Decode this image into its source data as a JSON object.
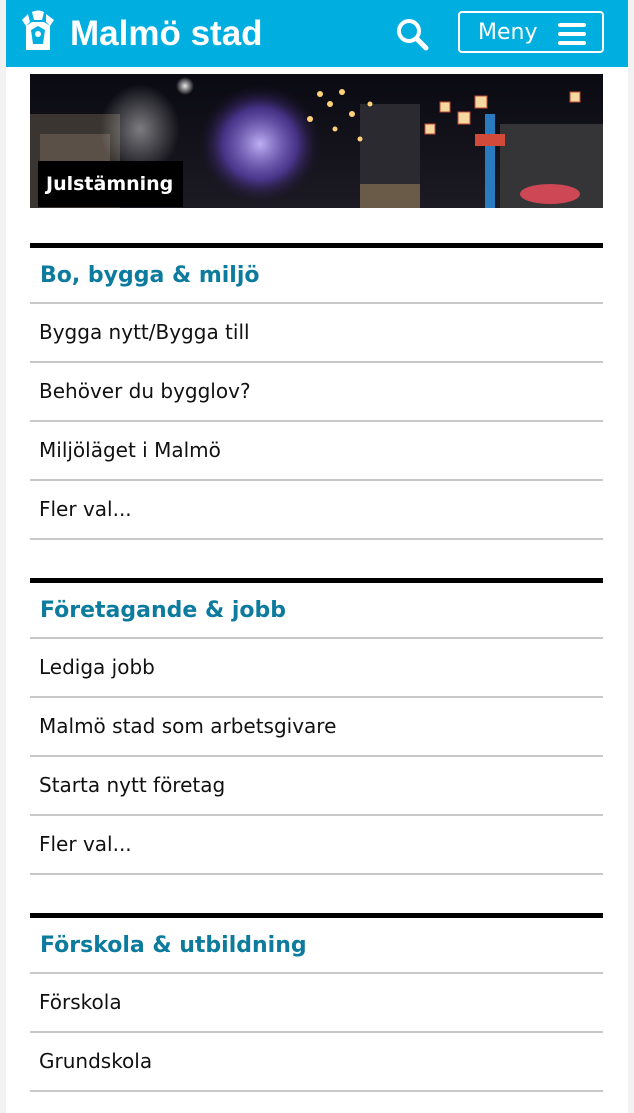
{
  "header": {
    "brand": "Malmö stad",
    "menu_label": "Meny",
    "accent": "#00aee0",
    "icons": {
      "logo": "malmo-griffin-logo",
      "search": "search-icon",
      "menu": "hamburger-icon"
    }
  },
  "hero": {
    "label": "Julstämning"
  },
  "sections": [
    {
      "title": "Bo, bygga & miljö",
      "items": [
        "Bygga nytt/Bygga till",
        "Behöver du bygglov?",
        "Miljöläget i Malmö",
        "Fler val..."
      ]
    },
    {
      "title": "Företagande & jobb",
      "items": [
        "Lediga jobb",
        "Malmö stad som arbetsgivare",
        "Starta nytt företag",
        "Fler val..."
      ]
    },
    {
      "title": "Förskola & utbildning",
      "items": [
        "Förskola",
        "Grundskola"
      ]
    }
  ],
  "colors": {
    "section_title": "#0d7b9e",
    "divider": "#c8c8c8"
  }
}
